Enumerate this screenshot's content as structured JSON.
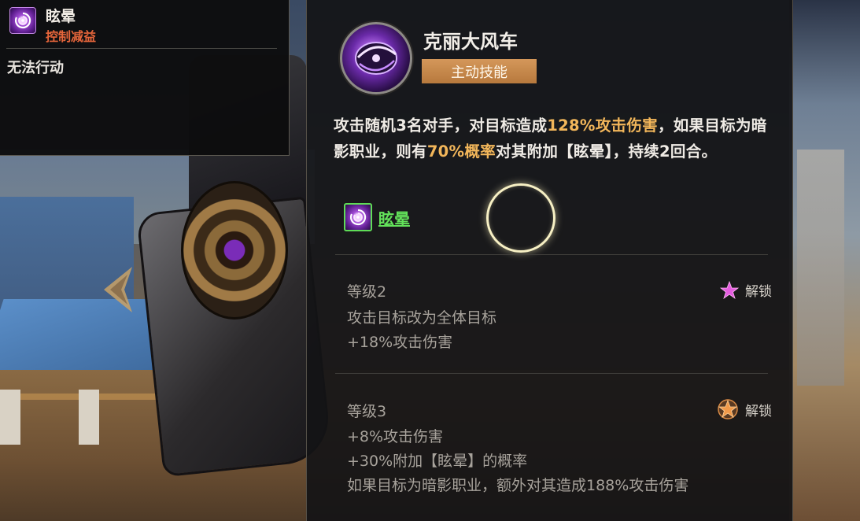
{
  "status_tooltip": {
    "name": "眩晕",
    "type": "控制减益",
    "description": "无法行动"
  },
  "skill": {
    "name": "克丽大风车",
    "type_badge": "主动技能",
    "description_parts": [
      {
        "text": "攻击随机3名对手，对目标造成",
        "highlight": false
      },
      {
        "text": "128%攻击伤害",
        "highlight": true
      },
      {
        "text": "，如果目标为暗影职业，则有",
        "highlight": false
      },
      {
        "text": "70%概率",
        "highlight": true
      },
      {
        "text": "对其附加【眩晕】，持续2回合。",
        "highlight": false
      }
    ],
    "linked_status": "眩晕"
  },
  "levels": [
    {
      "title": "等级2",
      "unlock_label": "解锁",
      "unlock_icon": "pink-star-icon",
      "lines": [
        "攻击目标改为全体目标",
        "+18%攻击伤害"
      ]
    },
    {
      "title": "等级3",
      "unlock_label": "解锁",
      "unlock_icon": "orange-star-icon",
      "lines": [
        "+8%攻击伤害",
        "+30%附加【眩晕】的概率",
        "如果目标为暗影职业，额外对其造成188%攻击伤害"
      ]
    }
  ],
  "colors": {
    "highlight": "#f2b65a",
    "debuff_type": "#e7663b",
    "link_green": "#63e25a",
    "badge": "#c98a4c"
  },
  "nav": {
    "left_arrow_icon": "chevron-left-icon"
  }
}
